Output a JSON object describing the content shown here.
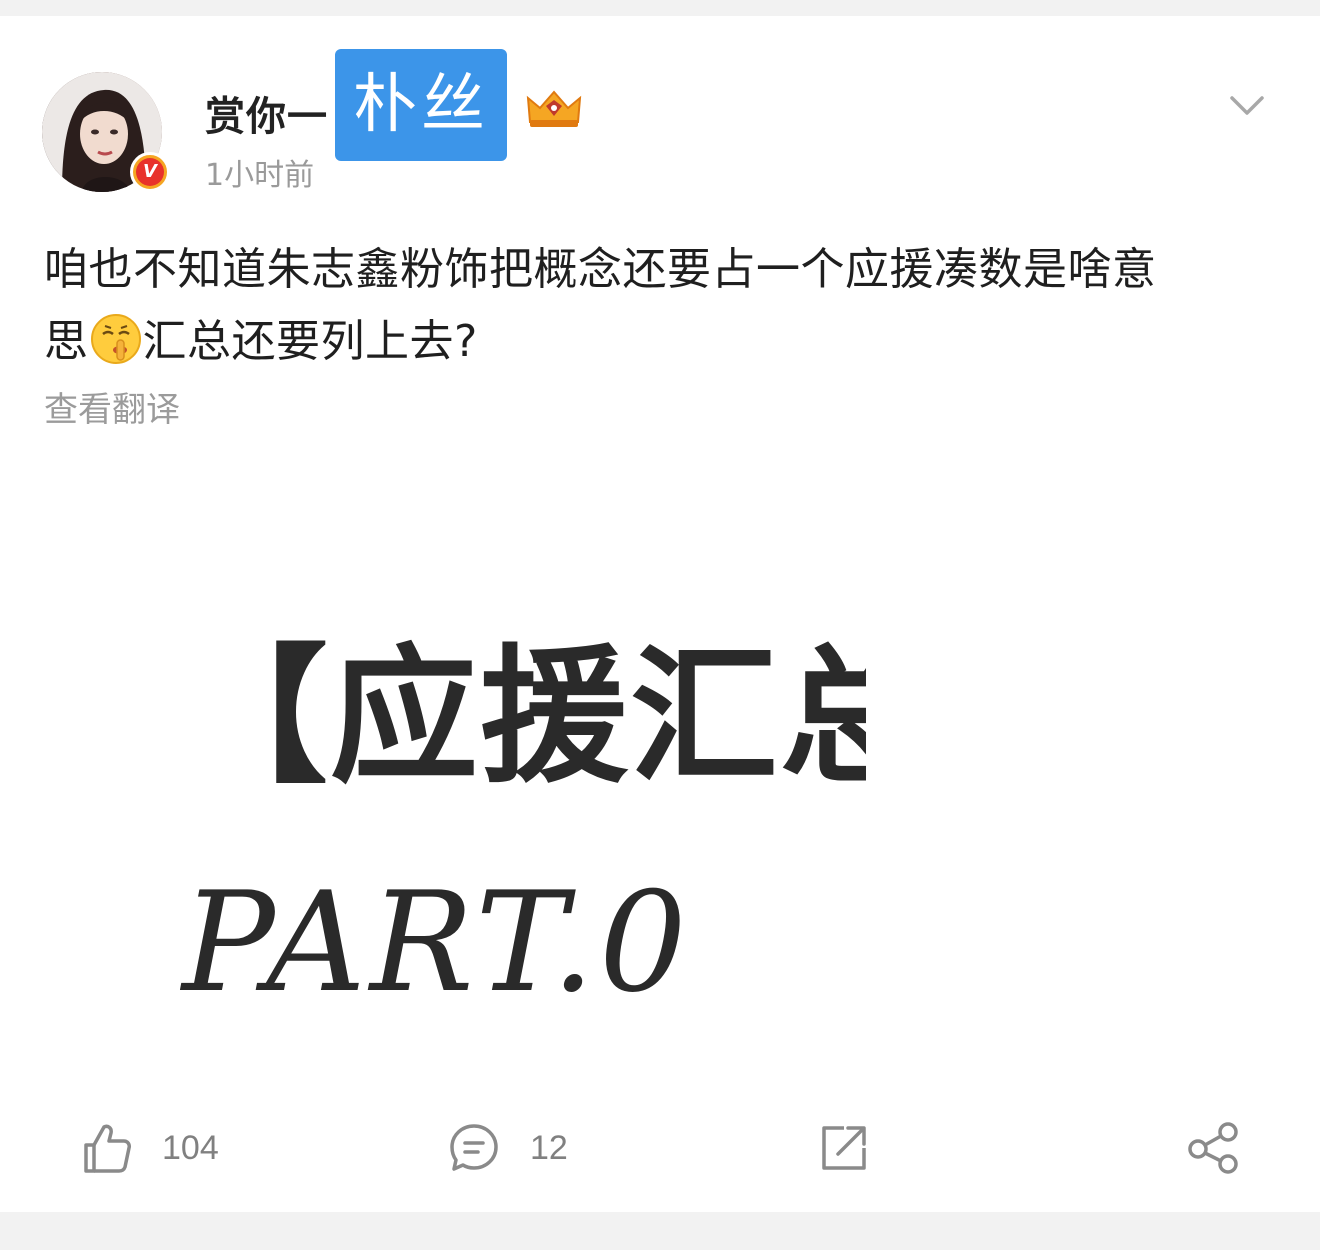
{
  "post": {
    "author": {
      "name": "赏你一",
      "name_overlay": "朴丝",
      "verified_badge": "V",
      "crown_icon": "crown-icon"
    },
    "time": "1小时前",
    "text_line1": "咱也不知道朱志鑫粉饰把概念还要占一个应援凑数是啥意",
    "text_line2_before": "思",
    "text_emoji": "shushing-face-emoji",
    "text_line2_after": "汇总还要列上去?",
    "translate_link": "查看翻译",
    "image": {
      "line1": "【应援汇总",
      "line2": "PART.0"
    }
  },
  "actions": {
    "likes": "104",
    "comments": "12"
  },
  "colors": {
    "overlay_blue": "#3c95e9",
    "verified_red": "#e8322b",
    "crown_gold": "#f5a623"
  }
}
